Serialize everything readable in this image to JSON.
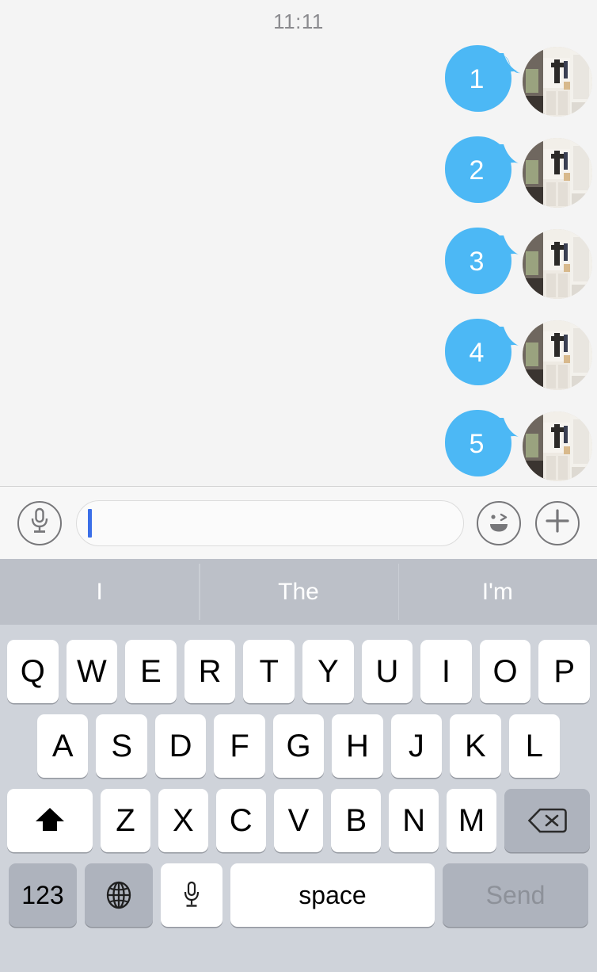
{
  "conversation": {
    "timestamp": "11:11",
    "messages": [
      {
        "text": "1",
        "avatar": "room-photo-avatar"
      },
      {
        "text": "2",
        "avatar": "room-photo-avatar"
      },
      {
        "text": "3",
        "avatar": "room-photo-avatar"
      },
      {
        "text": "4",
        "avatar": "room-photo-avatar"
      },
      {
        "text": "5",
        "avatar": "room-photo-avatar"
      }
    ],
    "bubble_color": "#4cb8f5",
    "bubble_text_color": "#ffffff",
    "background_color": "#f4f4f4"
  },
  "input_bar": {
    "mic_icon": "microphone-icon",
    "field_value": "",
    "field_placeholder": "",
    "caret_color": "#3b6fe8",
    "smiley_icon": "winking-face-icon",
    "plus_icon": "plus-icon",
    "background_color": "#f7f7f7"
  },
  "suggestions": {
    "items": [
      "I",
      "The",
      "I'm"
    ],
    "background_color": "#bcc0c8",
    "text_color": "#ffffff"
  },
  "keyboard": {
    "background_color": "#cfd3da",
    "row1": [
      "Q",
      "W",
      "E",
      "R",
      "T",
      "Y",
      "U",
      "I",
      "O",
      "P"
    ],
    "row2": [
      "A",
      "S",
      "D",
      "F",
      "G",
      "H",
      "J",
      "K",
      "L"
    ],
    "row3_letters": [
      "Z",
      "X",
      "C",
      "V",
      "B",
      "N",
      "M"
    ],
    "shift_icon": "shift-arrow-icon",
    "delete_icon": "backspace-icon",
    "numbers_label": "123",
    "globe_icon": "globe-icon",
    "dictation_icon": "microphone-icon",
    "space_label": "space",
    "send_label": "Send",
    "key_color": "#ffffff",
    "modifier_key_color": "#aeb3bd",
    "send_text_color": "#8d9199"
  }
}
